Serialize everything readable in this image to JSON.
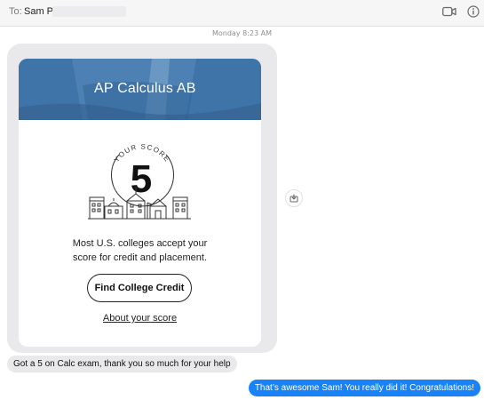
{
  "header": {
    "to_label": "To:",
    "recipient_name": "Sam  Pa",
    "icons": [
      "video-camera-icon",
      "info-icon"
    ]
  },
  "timestamp": "Monday 8:23 AM",
  "link_card": {
    "title": "AP Calculus AB",
    "score_caption": "YOUR SCORE",
    "score": "5",
    "body_line1": "Most U.S. colleges accept your",
    "body_line2": "score for credit and placement.",
    "cta_label": "Find College Credit",
    "link_label": "About your score",
    "banner_color": "#3f74a9"
  },
  "messages": {
    "received": "Got a 5 on Calc exam, thank you so much for your help",
    "sent": "That’s awesome Sam! You really did it! Congratulations!",
    "sent_color": "#1a82f7",
    "received_color": "#e9e9eb"
  }
}
